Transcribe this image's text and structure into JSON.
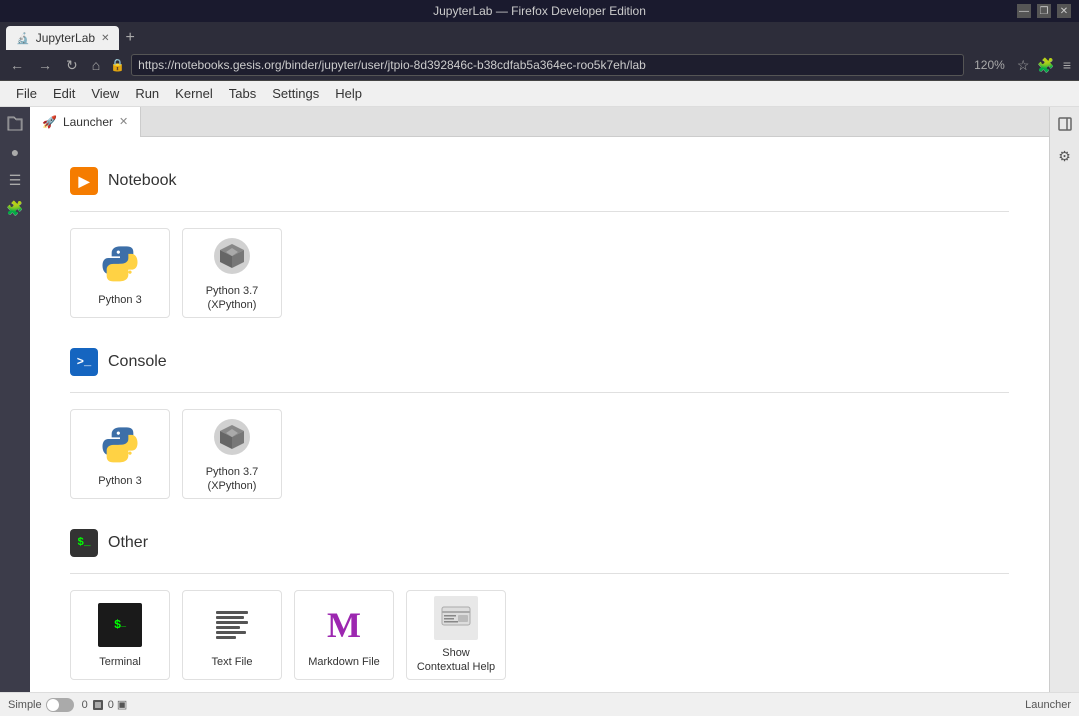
{
  "titlebar": {
    "title": "JupyterLab — Firefox Developer Edition",
    "btn_minimize": "—",
    "btn_restore": "❐",
    "btn_close": "✕"
  },
  "browser": {
    "tab_title": "JupyterLab",
    "url": "https://notebooks.gesis.org/binder/jupyter/user/jtpio-8d392846c-b38cdfab5a364ec-roo5k7eh/lab",
    "zoom": "120%"
  },
  "menu": {
    "items": [
      "File",
      "Edit",
      "View",
      "Run",
      "Kernel",
      "Tabs",
      "Settings",
      "Help"
    ]
  },
  "launcher_tab": {
    "label": "Launcher",
    "icon": "🚀"
  },
  "sections": [
    {
      "id": "notebook",
      "icon_label": "▶",
      "title": "Notebook",
      "icon_type": "notebook",
      "items": [
        {
          "id": "python3",
          "label": "Python 3",
          "icon_type": "python3"
        },
        {
          "id": "python37xpython",
          "label": "Python 3.7\n(XPython)",
          "icon_type": "xpython"
        }
      ]
    },
    {
      "id": "console",
      "icon_label": ">_",
      "title": "Console",
      "icon_type": "console",
      "items": [
        {
          "id": "console-python3",
          "label": "Python 3",
          "icon_type": "python3"
        },
        {
          "id": "console-python37xpython",
          "label": "Python 3.7\n(XPython)",
          "icon_type": "xpython"
        }
      ]
    },
    {
      "id": "other",
      "icon_label": "$_",
      "title": "Other",
      "icon_type": "other",
      "items": [
        {
          "id": "terminal",
          "label": "Terminal",
          "icon_type": "terminal"
        },
        {
          "id": "textfile",
          "label": "Text File",
          "icon_type": "textfile"
        },
        {
          "id": "markdown",
          "label": "Markdown File",
          "icon_type": "markdown"
        },
        {
          "id": "contextual",
          "label": "Show Contextual Help",
          "icon_type": "contextual"
        }
      ]
    }
  ],
  "statusbar": {
    "mode": "Simple",
    "kernel_count": "0",
    "terminal_count": "0",
    "right_label": "Launcher"
  }
}
